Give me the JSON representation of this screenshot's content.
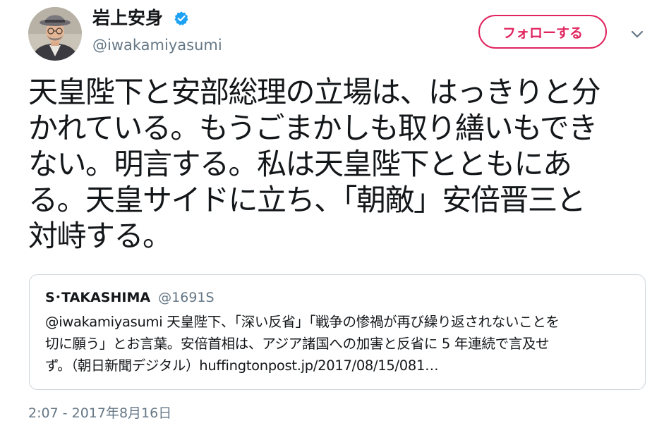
{
  "user": {
    "display_name": "岩上安身",
    "handle": "@iwakamiyasumi",
    "avatar_icon": "avatar-photo",
    "verified_icon": "verified-badge-icon"
  },
  "follow_button": {
    "label": "フォローする"
  },
  "menu_icon": "chevron-down-icon",
  "tweet": {
    "lines": [
      "天皇陛下と安部総理の立場は、はっきりと分",
      "かれている。もうごまかしも取り繕いもでき",
      "ない。明言する。私は天皇陛下とともにあ",
      "る。天皇サイドに立ち、「朝敵」安倍晋三と",
      "対峙する。"
    ]
  },
  "quote": {
    "name": "S･TAKASHIMA",
    "handle": "@1691S",
    "lines": [
      "@iwakamiyasumi 天皇陛下、「深い反省」「戦争の惨禍が再び繰り返されないことを",
      "切に願う」とお言葉。安倍首相は、アジア諸国への加害と反省に 5 年連続で言及せ",
      "ず。（朝日新聞デジタル）huffingtonpost.jp/2017/08/15/081…"
    ]
  },
  "timestamp": "2:07 - 2017年8月16日",
  "colors": {
    "follow_accent": "#e0245e",
    "verified": "#1da1f2",
    "secondary_text": "#657786",
    "border": "#ccd6dd"
  }
}
